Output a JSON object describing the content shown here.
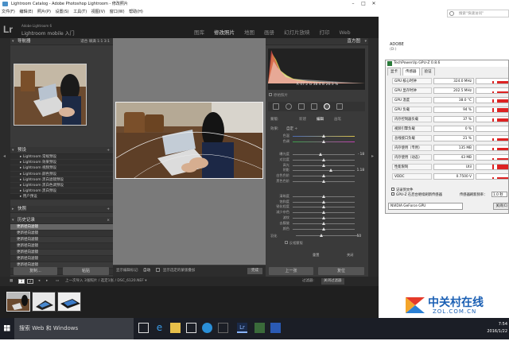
{
  "lightroom": {
    "title": "Lightroom Catalog - Adobe Photoshop Lightroom - 修改照片",
    "menu": [
      "文件(F)",
      "编辑(E)",
      "照片(P)",
      "设置(S)",
      "工具(T)",
      "视图(V)",
      "窗口(W)",
      "帮助(H)"
    ],
    "logo": "Lr",
    "brand_line1": "Adobe Lightroom 6",
    "brand_line2": "Lightroom mobile 入门",
    "modules": [
      "图库",
      "修改照片",
      "地图",
      "画册",
      "幻灯片放映",
      "打印",
      "Web"
    ],
    "active_module": "修改照片",
    "left_panel": {
      "navigator": "导航器",
      "navigator_zoom": "适合  填满  1:1  3:1",
      "presets_header": "预设",
      "presets": [
        "Lightroom 常规预设",
        "Lightroom 效果预设",
        "Lightroom 视频预设",
        "Lightroom 颜色预设",
        "Lightroom 黑白滤镜预设",
        "Lightroom 黑白色调预设",
        "Lightroom 黑白预设",
        "用户预设"
      ],
      "snapshots_header": "快照",
      "history_header": "历史记录",
      "history": [
        "更新径向滤镜",
        "更新径向滤镜",
        "更新径向滤镜",
        "更新径向滤镜",
        "更新径向滤镜",
        "更新径向滤镜",
        "更新径向滤镜",
        "更新径向滤镜"
      ],
      "copy_button": "复制...",
      "paste_button": "粘贴"
    },
    "toolbar": {
      "show_mask": "显示编辑标记:",
      "mask_value": "自动",
      "show_overlay": "显示选定的蒙版叠加",
      "done": "完成"
    },
    "right_panel": {
      "histogram_header": "直方图",
      "histogram_info": "ISO 250   35 mm   f/2.8   1/25 秒",
      "rgb_readout": "R  47.2   G  38.4   B  26.3 %",
      "original_photo": "原始照片",
      "mask_label": "蒙版:",
      "mask_new": "新建",
      "mask_edit": "编辑",
      "mask_brush": "画笔",
      "effect_label": "效果:",
      "effect_value": "自定 ÷",
      "sliders": [
        {
          "label": "色温",
          "value": ""
        },
        {
          "label": "色调",
          "value": ""
        },
        {
          "label": "曝光度",
          "value": "- 18",
          "pos": 0.46
        },
        {
          "label": "对比度",
          "value": "",
          "pos": 0.5
        },
        {
          "label": "高光",
          "value": "",
          "pos": 0.5
        },
        {
          "label": "阴影",
          "value": "1.18",
          "pos": 0.62
        },
        {
          "label": "白色色阶",
          "value": "",
          "pos": 0.5
        },
        {
          "label": "黑色色阶",
          "value": "",
          "pos": 0.5
        },
        {
          "label": "清晰度",
          "value": "",
          "pos": 0.5
        },
        {
          "label": "饱和度",
          "value": "",
          "pos": 0.5
        },
        {
          "label": "锐化程度",
          "value": "",
          "pos": 0.5
        },
        {
          "label": "减少杂色",
          "value": "",
          "pos": 0.5
        },
        {
          "label": "波纹",
          "value": "",
          "pos": 0.5
        },
        {
          "label": "去朦胧",
          "value": "",
          "pos": 0.5
        },
        {
          "label": "颜色",
          "value": "",
          "pos": 0.5
        }
      ],
      "feather_label": "羽化",
      "feather_value": "50",
      "invert_label": "反相蒙版",
      "reset": "重置",
      "close": "关闭",
      "prev_button": "上一张",
      "reset_button": "复位"
    },
    "filmstrip_bar": {
      "pages": [
        "1",
        "2"
      ],
      "info": "上一次导入  3张照片 / 选定1张 / DSC_6120.NEF ▾",
      "filter_label": "过滤器:",
      "filter_value": "关闭过滤器"
    }
  },
  "explorer": {
    "search_placeholder": "搜索\"快速访问\"",
    "item": "ADOBE",
    "item_sub": "(D:)"
  },
  "gpuz": {
    "title": "TechPowerUp GPU-Z 0.8.6",
    "tabs": [
      "显卡",
      "传感器",
      "验证"
    ],
    "active_tab": "传感器",
    "rows": [
      {
        "label": "GPU 核心时钟",
        "value": "324.0 MHz",
        "fill": 0.35
      },
      {
        "label": "GPU 显存时钟",
        "value": "202.5 MHz",
        "fill": 0.3
      },
      {
        "label": "GPU 温度",
        "value": "38.0 °C",
        "fill": 0.5
      },
      {
        "label": "GPU 负载",
        "value": "94 %",
        "fill": 0.6
      },
      {
        "label": "内存控制器负载",
        "value": "37 %",
        "fill": 0.45
      },
      {
        "label": "视频引擎负载",
        "value": "0 %",
        "fill": 0.0
      },
      {
        "label": "总线接口负载",
        "value": "21 %",
        "fill": 0.35
      },
      {
        "label": "内存使用（专用）",
        "value": "135 MB",
        "fill": 0.4
      },
      {
        "label": "内存使用（动态）",
        "value": "43 MB",
        "fill": 0.3
      },
      {
        "label": "性能限制",
        "value": "Util",
        "fill": 0.7
      },
      {
        "label": "VDDC",
        "value": "0.7500 V",
        "fill": 0.3
      }
    ],
    "log_to_file": "记录到文件",
    "continue_refresh": "GPU-Z 在后台继续刷新传感器",
    "refresh_rate_label": "传感器刷新频率：",
    "refresh_rate": "1.0 秒",
    "gpu_select": "NVIDIA GeForce GPU",
    "close_button": "关闭(C)"
  },
  "watermark": {
    "brand": "中关村在线",
    "domain": "ZOL.COM.CN"
  },
  "taskbar": {
    "search": "搜索 Web 和 Windows",
    "time": "7:54",
    "date": "2016/1/22"
  }
}
